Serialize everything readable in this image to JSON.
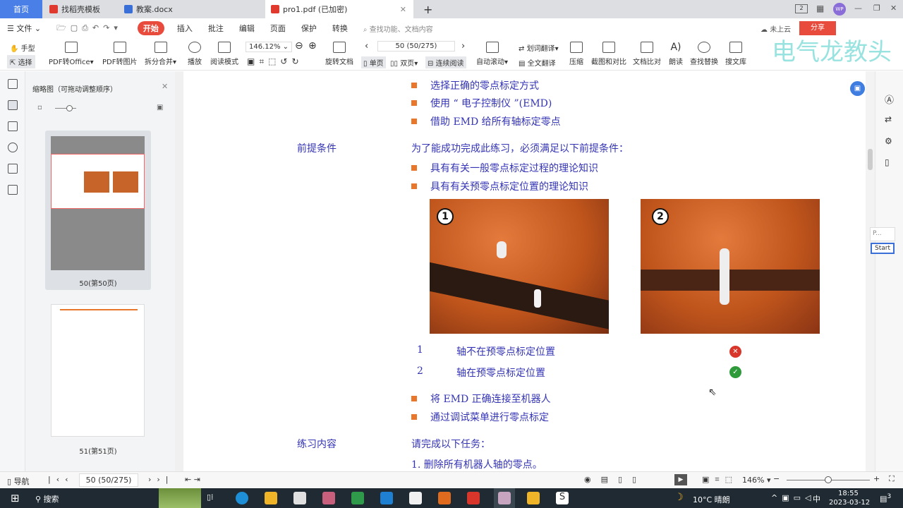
{
  "tabs": [
    {
      "label": "首页",
      "active": false
    },
    {
      "label": "找稻壳模板"
    },
    {
      "label": "教案.docx"
    },
    {
      "label": "pro1.pdf  (已加密)",
      "active": true
    }
  ],
  "titlebar": {
    "avatar": "WP",
    "new_tab": "+"
  },
  "menu": {
    "file": "文件",
    "items": [
      "开始",
      "插入",
      "批注",
      "编辑",
      "页面",
      "保护",
      "转换"
    ],
    "search_placeholder": "查找功能、文档内容",
    "cloud": "未上云",
    "share": "分享"
  },
  "toolbar": {
    "hand": "手型",
    "select": "选择",
    "pdf_office": "PDF转Office",
    "pdf_image": "PDF转图片",
    "split": "拆分合并",
    "play": "播放",
    "read_mode": "阅读模式",
    "zoom": "146.12%",
    "rotate": "旋转文档",
    "page_input": "50 (50/275)",
    "single": "单页",
    "double": "双页",
    "continuous": "连续阅读",
    "auto_scroll": "自动滚动",
    "word_translate": "划词翻译",
    "full_translate": "全文翻译",
    "compress": "压缩",
    "screenshot": "截图和对比",
    "compare": "文档比对",
    "read_aloud": "朗读",
    "find_replace": "查找替换",
    "library": "搜文库"
  },
  "watermark": "电气龙教头",
  "thumbs": {
    "title": "缩略图（可拖动调整顺序）",
    "pages": [
      {
        "label": "50(第50页)"
      },
      {
        "label": "51(第51页)"
      }
    ]
  },
  "doc": {
    "bullets1": [
      "选择正确的零点标定方式",
      "使用 “ 电子控制仪 ”(EMD)",
      "借助 EMD 给所有轴标定零点"
    ],
    "prereq_label": "前提条件",
    "prereq_intro": "为了能成功完成此练习，必须满足以下前提条件：",
    "bullets2": [
      "具有有关一般零点标定过程的理论知识",
      "具有有关预零点标定位置的理论知识"
    ],
    "photos": [
      {
        "num": "1"
      },
      {
        "num": "2"
      }
    ],
    "legend": [
      {
        "num": "1",
        "text": "轴不在预零点标定位置",
        "status": "wrong"
      },
      {
        "num": "2",
        "text": "轴在预零点标定位置",
        "status": "correct"
      }
    ],
    "bullets3": [
      "将 EMD 正确连接至机器人",
      "通过调试菜单进行零点标定"
    ],
    "exercise_label": "练习内容",
    "exercise_intro": "请完成以下任务：",
    "task1": "1.  删除所有机器人轴的零点。"
  },
  "float_widget": {
    "label": "P...",
    "button": "Start"
  },
  "status": {
    "nav": "导航",
    "page": "50 (50/275)",
    "zoom": "146%"
  },
  "taskbar": {
    "search": "搜索",
    "weather": "10°C 晴朗",
    "ime": "中",
    "time": "18:55",
    "date": "2023-03-12",
    "notif": "3"
  },
  "colors": {
    "accent": "#e84b3c",
    "doc_text": "#3434b4",
    "bullet": "#e8762b",
    "tab_home": "#4a7fe8"
  }
}
